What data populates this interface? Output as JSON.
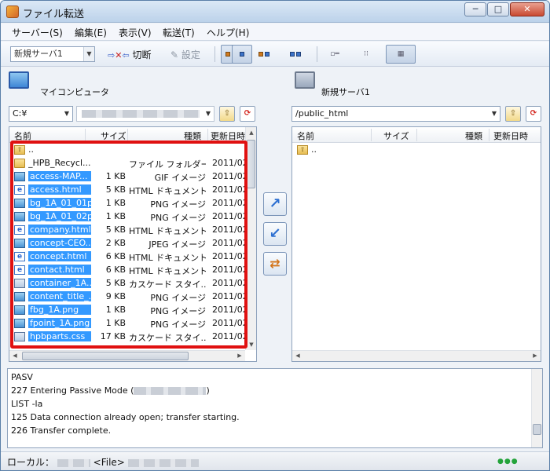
{
  "window": {
    "title": "ファイル転送",
    "min": "─",
    "max": "□",
    "close": "✕"
  },
  "menu": [
    "サーバー(S)",
    "編集(E)",
    "表示(V)",
    "転送(T)",
    "ヘルプ(H)"
  ],
  "toolbar": {
    "server_value": "新規サーバ1",
    "disconnect": "切断",
    "settings": "設定"
  },
  "local": {
    "title": "マイコンピュータ",
    "drive": "C:¥",
    "columns": [
      "名前",
      "サイズ",
      "種類",
      "更新日時"
    ],
    "rows": [
      {
        "name": "..",
        "size": "",
        "type": "",
        "date": "",
        "icon": "up-folder-icon",
        "selected": false
      },
      {
        "name": "_HPB_Recycl...",
        "size": "",
        "type": "ファイル フォルダー",
        "date": "2011/02",
        "icon": "folder-icon",
        "selected": false
      },
      {
        "name": "access-MAP...",
        "size": "1 KB",
        "type": "GIF イメージ",
        "date": "2011/02",
        "icon": "image-file-icon",
        "selected": true
      },
      {
        "name": "access.html",
        "size": "5 KB",
        "type": "HTML ドキュメント",
        "date": "2011/02",
        "icon": "html-file-icon",
        "selected": true
      },
      {
        "name": "bg_1A_01_01p...",
        "size": "1 KB",
        "type": "PNG イメージ",
        "date": "2011/02",
        "icon": "image-file-icon",
        "selected": true
      },
      {
        "name": "bg_1A_01_02p...",
        "size": "1 KB",
        "type": "PNG イメージ",
        "date": "2011/02",
        "icon": "image-file-icon",
        "selected": true
      },
      {
        "name": "company.html",
        "size": "5 KB",
        "type": "HTML ドキュメント",
        "date": "2011/02",
        "icon": "html-file-icon",
        "selected": true
      },
      {
        "name": "concept-CEO...",
        "size": "2 KB",
        "type": "JPEG イメージ",
        "date": "2011/02",
        "icon": "image-file-icon",
        "selected": true
      },
      {
        "name": "concept.html",
        "size": "6 KB",
        "type": "HTML ドキュメント",
        "date": "2011/02",
        "icon": "html-file-icon",
        "selected": true
      },
      {
        "name": "contact.html",
        "size": "6 KB",
        "type": "HTML ドキュメント",
        "date": "2011/02",
        "icon": "html-file-icon",
        "selected": true
      },
      {
        "name": "container_1A...",
        "size": "5 KB",
        "type": "カスケード スタイ...",
        "date": "2011/02",
        "icon": "css-file-icon",
        "selected": true
      },
      {
        "name": "content_title_...",
        "size": "9 KB",
        "type": "PNG イメージ",
        "date": "2011/02",
        "icon": "image-file-icon",
        "selected": true
      },
      {
        "name": "fbg_1A.png",
        "size": "1 KB",
        "type": "PNG イメージ",
        "date": "2011/02",
        "icon": "image-file-icon",
        "selected": true
      },
      {
        "name": "fpoint_1A.png",
        "size": "1 KB",
        "type": "PNG イメージ",
        "date": "2011/02",
        "icon": "image-file-icon",
        "selected": true
      },
      {
        "name": "hpbparts.css",
        "size": "17 KB",
        "type": "カスケード スタイ...",
        "date": "2011/02",
        "icon": "css-file-icon",
        "selected": true
      }
    ]
  },
  "remote": {
    "title": "新規サーバ1",
    "path": "/public_html",
    "columns": [
      "名前",
      "サイズ",
      "種類",
      "更新日時"
    ],
    "rows": [
      {
        "name": "..",
        "icon": "up-folder-icon"
      }
    ]
  },
  "log": [
    "PASV",
    "227  Entering Passive Mode (",
    "LIST -la",
    "125  Data connection already open; transfer starting.",
    "226  Transfer complete."
  ],
  "log_close_paren": ")",
  "status": {
    "local_label": "ローカル：",
    "file_label": "<File>"
  },
  "colors": {
    "selection": "#3399ff",
    "highlight_border": "#e01010"
  }
}
